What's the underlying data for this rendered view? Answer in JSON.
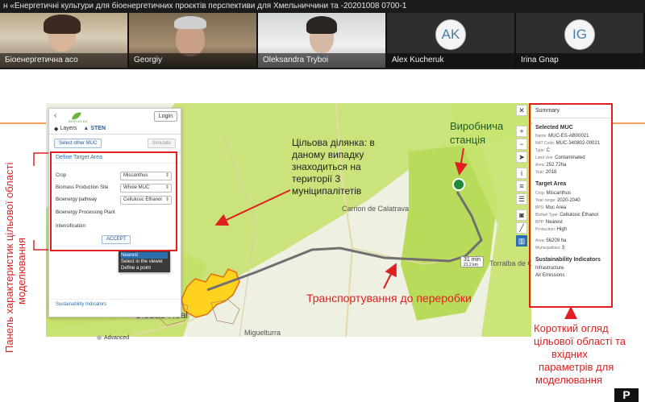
{
  "meeting": {
    "title": "н «Енергетичні культури для біоенергетичних проєктів перспективи для Хмельниччини та -20201008 0700-1"
  },
  "participants": [
    {
      "name": "Біоенергетична асо",
      "type": "video"
    },
    {
      "name": "Georgiy",
      "type": "video"
    },
    {
      "name": "Oleksandra Tryboi",
      "type": "video"
    },
    {
      "name": "Alex Kucheruk",
      "type": "avatar",
      "initials": "AK"
    },
    {
      "name": "Irina Gnap",
      "type": "avatar",
      "initials": "IG"
    }
  ],
  "panel": {
    "logo_text": "BIOPLAT-EU",
    "login_label": "Login",
    "tabs": [
      {
        "icon": "layers-icon",
        "label": "Layers"
      },
      {
        "icon": "sten-icon",
        "label": "STEN"
      }
    ],
    "select_muc_label": "Select other MUC",
    "simulate_label": "Simulate",
    "define_target_area": "Define Target Area",
    "fields": [
      {
        "label": "Crop",
        "value": "Miscanthus"
      },
      {
        "label": "Biomass Production Site",
        "value": "Whole MUC"
      },
      {
        "label": "Bioenergy pathway",
        "value": "Cellulosic Ethanol"
      },
      {
        "label": "Bioenergy Processing Plant",
        "value": "Nearest"
      },
      {
        "label": "Intensification:",
        "value": ""
      }
    ],
    "dropdown_options": [
      "Nearest",
      "Select in the viewer",
      "Define a point"
    ],
    "accept_label": "ACCEPT",
    "sustainability_label": "Sustainability Indicators",
    "advanced_label": "Advanced"
  },
  "map": {
    "labels": {
      "carrion": "Carrion de Calatrava",
      "ciudad_real": "Ciudad Real",
      "torralba": "Torralba de Calatrava",
      "miguelturra": "Miguelturra"
    },
    "route_time": "31 min",
    "route_distance": "21.2 km",
    "tools": [
      "close-icon",
      "plus-icon",
      "minus-icon",
      "locate-icon",
      "info-icon",
      "layers-list-icon",
      "list-icon",
      "camera-icon",
      "ruler-icon",
      "chart-icon"
    ]
  },
  "summary": {
    "title": "Summary",
    "selected_muc_title": "Selected MUC",
    "muc": [
      {
        "key": "Name",
        "value": "MUC-ES-AB00021"
      },
      {
        "key": "NAT Code",
        "value": "MUC-340802-00021"
      },
      {
        "key": "Type",
        "value": "C"
      },
      {
        "key": "Land Use",
        "value": "Contaminated"
      },
      {
        "key": "Area",
        "value": "252.72ha"
      },
      {
        "key": "Year",
        "value": "2018"
      }
    ],
    "target_area_title": "Target Area",
    "target": [
      {
        "key": "Crop",
        "value": "Miscanthus"
      },
      {
        "key": "Year range",
        "value": "2020-2040"
      },
      {
        "key": "BPS",
        "value": "Muc Area"
      },
      {
        "key": "Biofuel Type",
        "value": "Cellulosic Ethanol"
      },
      {
        "key": "BPP",
        "value": "Nearest"
      },
      {
        "key": "Production",
        "value": "High"
      },
      {
        "key": "Area",
        "value": "56209 ha"
      },
      {
        "key": "Municipalities",
        "value": "3"
      }
    ],
    "sust_title": "Sustainability Indicators",
    "sust_items": [
      "Infrastructure",
      "Air Emissions"
    ]
  },
  "annotations": {
    "target_area_text": [
      "Цільова ділянка: в",
      "даному випадку",
      "знаходиться на",
      "території 3",
      "муніципалітетів"
    ],
    "station_text": [
      "Виробнича",
      "станція"
    ],
    "transport_text": "Транспортування до переробки",
    "summary_text": [
      "Короткий огляд",
      "цільової області та",
      "вхідних",
      "параметрів для",
      "моделювання"
    ],
    "vertical_text": [
      "Панель характеристик цільової області",
      "моделювання"
    ]
  },
  "colors": {
    "accent_red": "#e02020",
    "map_green": "#c4e068",
    "target_yellow": "#ffd21e",
    "route_gray": "#6f6f6f",
    "link_blue": "#2b6fb0"
  }
}
